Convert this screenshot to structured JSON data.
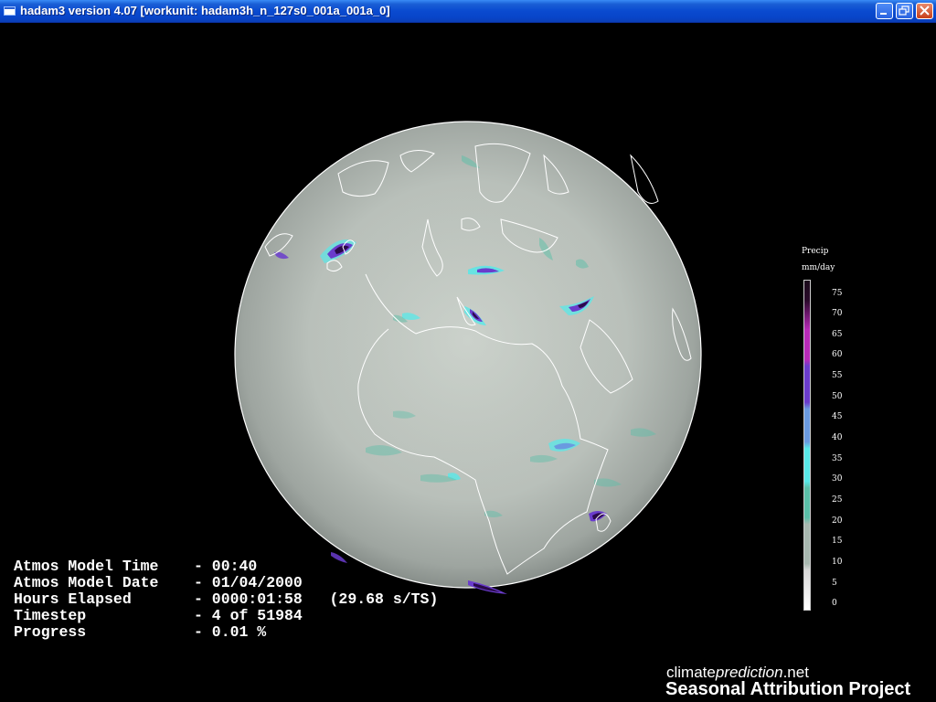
{
  "window": {
    "title": "hadam3 version 4.07 [workunit: hadam3h_n_127s0_001a_001a_0]",
    "controls": [
      "minimize-icon",
      "restore-icon",
      "close-icon"
    ]
  },
  "legend": {
    "title": "Precip",
    "units": "mm/day",
    "ticks": [
      "75",
      "70",
      "65",
      "60",
      "55",
      "50",
      "45",
      "40",
      "35",
      "30",
      "25",
      "20",
      "15",
      "10",
      "5",
      "0"
    ]
  },
  "stats": [
    {
      "label": "Atmos Model Time",
      "value": "- 00:40"
    },
    {
      "label": "Atmos Model Date",
      "value": "- 01/04/2000"
    },
    {
      "label": "Hours Elapsed",
      "value": "- 0000:01:58   (29.68 s/TS)"
    },
    {
      "label": "Timestep",
      "value": "- 4 of 51984"
    },
    {
      "label": "Progress",
      "value": "- 0.01 %"
    }
  ],
  "branding": {
    "part1": "climate",
    "part2": "prediction",
    "part3": ".net",
    "project": "Seasonal Attribution Project"
  },
  "colors": {
    "titlebar": "#0a4ad0",
    "globe": "#bcc2bc",
    "coastline": "#ffffff",
    "precip_cyan": "#58e8e8",
    "precip_purple": "#6a3ccc",
    "precip_dark": "#2a0a4a"
  }
}
